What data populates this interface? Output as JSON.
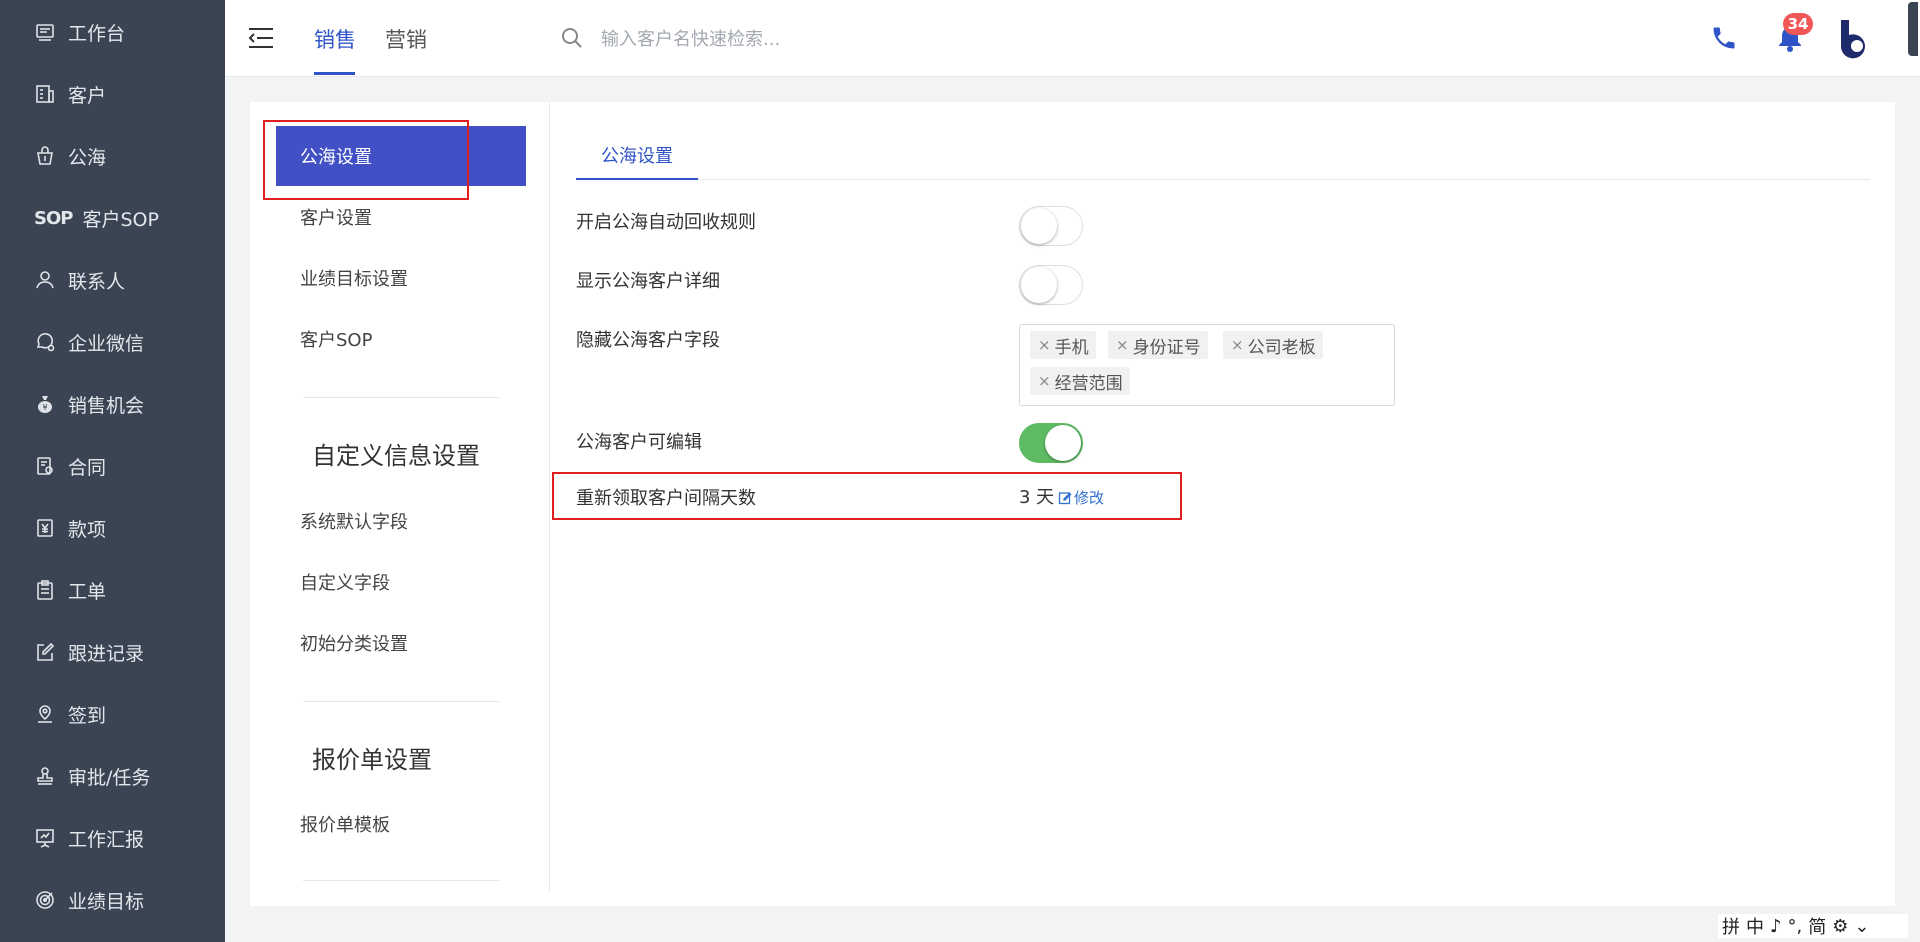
{
  "sidebar": {
    "items": [
      {
        "label": "工作台",
        "icon": "workbench-icon"
      },
      {
        "label": "客户",
        "icon": "customer-icon"
      },
      {
        "label": "公海",
        "icon": "public-pool-icon"
      },
      {
        "label": "客户SOP",
        "icon": "sop-icon",
        "glyph": "SOP"
      },
      {
        "label": "联系人",
        "icon": "contact-icon"
      },
      {
        "label": "企业微信",
        "icon": "wecom-icon"
      },
      {
        "label": "销售机会",
        "icon": "opportunity-icon"
      },
      {
        "label": "合同",
        "icon": "contract-icon"
      },
      {
        "label": "款项",
        "icon": "payment-icon"
      },
      {
        "label": "工单",
        "icon": "ticket-icon"
      },
      {
        "label": "跟进记录",
        "icon": "followup-icon"
      },
      {
        "label": "签到",
        "icon": "checkin-icon"
      },
      {
        "label": "审批/任务",
        "icon": "approval-icon"
      },
      {
        "label": "工作汇报",
        "icon": "report-icon"
      },
      {
        "label": "业绩目标",
        "icon": "target-icon"
      }
    ]
  },
  "header": {
    "tabs": [
      {
        "label": "销售",
        "active": true
      },
      {
        "label": "营销",
        "active": false
      }
    ],
    "search": {
      "placeholder": "输入客户名快速检索...",
      "value": ""
    },
    "notification_count": "34",
    "accent": "#2f54c8"
  },
  "settings_nav": {
    "items": [
      {
        "label": "公海设置",
        "active": true
      },
      {
        "label": "客户设置"
      },
      {
        "label": "业绩目标设置"
      },
      {
        "label": "客户SOP"
      }
    ],
    "custom_heading": "自定义信息设置",
    "custom_items": [
      {
        "label": "系统默认字段"
      },
      {
        "label": "自定义字段"
      },
      {
        "label": "初始分类设置"
      }
    ],
    "quote_heading": "报价单设置",
    "quote_items": [
      {
        "label": "报价单模板"
      }
    ]
  },
  "panel": {
    "tab_label": "公海设置",
    "rows": {
      "auto_recycle": {
        "label": "开启公海自动回收规则",
        "on": false
      },
      "show_detail": {
        "label": "显示公海客户详细",
        "on": false
      },
      "hidden_fields": {
        "label": "隐藏公海客户字段",
        "tags": [
          "手机",
          "身份证号",
          "公司老板",
          "经营范围"
        ]
      },
      "editable": {
        "label": "公海客户可编辑",
        "on": true
      },
      "reclaim_interval": {
        "label": "重新领取客户间隔天数",
        "value": "3 天",
        "edit_label": "修改"
      }
    }
  },
  "ime": {
    "items": [
      "拼",
      "中",
      "♪",
      "°,",
      "简",
      "⚙",
      "⌄"
    ]
  },
  "colors": {
    "sidebar_bg": "#3a4452",
    "active_nav": "#4151c5",
    "toggle_on": "#5dbb63",
    "highlight": "#e02020"
  }
}
